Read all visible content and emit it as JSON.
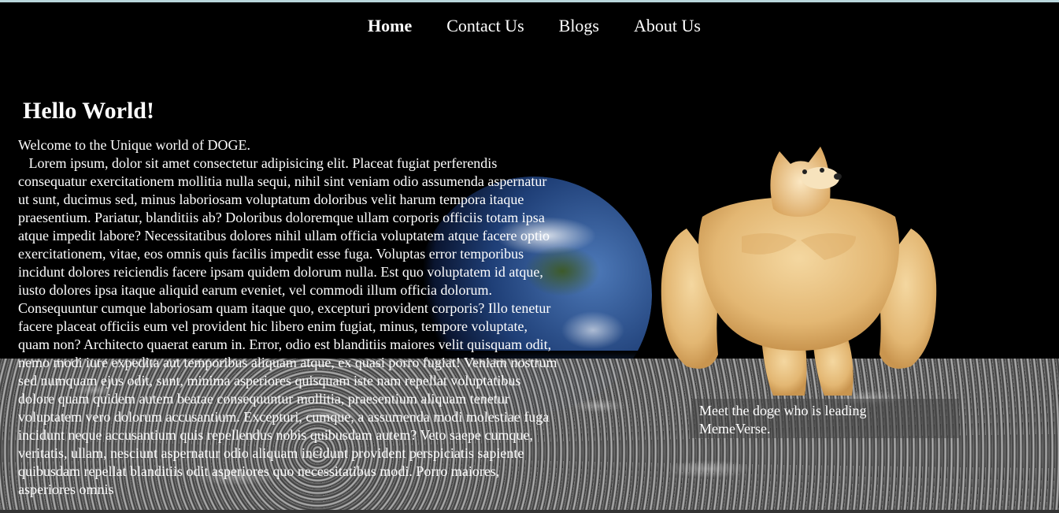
{
  "nav": {
    "items": [
      {
        "label": "Home",
        "active": true
      },
      {
        "label": "Contact Us",
        "active": false
      },
      {
        "label": "Blogs",
        "active": false
      },
      {
        "label": "About Us",
        "active": false
      }
    ]
  },
  "hero": {
    "title": "Hello World!",
    "body": "Welcome to the Unique world of DOGE.\n   Lorem ipsum, dolor sit amet consectetur adipisicing elit. Placeat fugiat perferendis consequatur exercitationem mollitia nulla sequi, nihil sint veniam odio assumenda aspernatur ut sunt, ducimus sed, minus laboriosam voluptatum doloribus velit harum tempora itaque praesentium. Pariatur, blanditiis ab? Doloribus doloremque ullam corporis officiis totam ipsa atque impedit labore? Necessitatibus dolores nihil ullam officia voluptatem atque facere optio exercitationem, vitae, eos omnis quis facilis impedit esse fuga. Voluptas error temporibus incidunt dolores reiciendis facere ipsam quidem dolorum nulla. Est quo voluptatem id atque, iusto dolores ipsa itaque aliquid earum eveniet, vel commodi illum officia dolorum. Consequuntur cumque laboriosam quam itaque quo, excepturi provident corporis? Illo tenetur facere placeat officiis eum vel provident hic libero enim fugiat, minus, tempore voluptate, quam non? Architecto quaerat earum in. Error, odio est blanditiis maiores velit quisquam odit, nemo modi iure expedita aut temporibus aliquam atque, ex quasi porro fugiat! Veniam nostrum sed numquam ejus odit, sunt, minima asperiores quisquam iste nam repellat voluptatibus dolore quam quidem autem beatae consequuntur mollitia, praesentium aliquam tenetur voluptatem vero dolorum accusantium. Excepturi, cumque, a assumenda modi molestiae fuga incidunt neque accusantium quis repellendus nobis quibusdam autem? Veto saepe cumque, veritatis, ullam, nesciunt aspernatur odio aliquam incidunt provident perspiciatis sapiente quibusdam repellat blanditiis odit asperiores quo necessitatibus modi. Porro maiores, asperiores omnis"
  },
  "doge": {
    "caption": "Meet the doge who is leading MemeVerse.",
    "fur_color": "#e8c17e"
  },
  "colors": {
    "background": "#000000",
    "top_edge": "#b9d6dc"
  }
}
